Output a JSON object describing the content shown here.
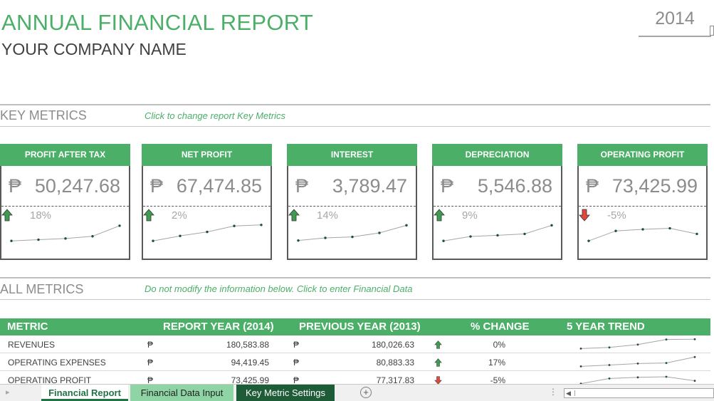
{
  "header": {
    "title": "ANNUAL FINANCIAL REPORT",
    "company": "YOUR COMPANY NAME",
    "year": "2014"
  },
  "key_metrics": {
    "title": "KEY METRICS",
    "note": "Click to change report Key Metrics",
    "currency": "₱",
    "cards": [
      {
        "label": "PROFIT AFTER TAX",
        "value": "50,247.68",
        "change": "18%",
        "direction": "up",
        "trend": [
          0.1,
          0.16,
          0.22,
          0.33,
          0.86
        ]
      },
      {
        "label": "NET PROFIT",
        "value": "67,474.85",
        "change": "2%",
        "direction": "up",
        "trend": [
          0.1,
          0.35,
          0.55,
          0.85,
          0.9
        ]
      },
      {
        "label": "INTEREST",
        "value": "3,789.47",
        "change": "14%",
        "direction": "up",
        "trend": [
          0.12,
          0.25,
          0.3,
          0.5,
          0.88
        ]
      },
      {
        "label": "DEPRECIATION",
        "value": "5,546.88",
        "change": "9%",
        "direction": "up",
        "trend": [
          0.1,
          0.32,
          0.38,
          0.45,
          0.88
        ]
      },
      {
        "label": "OPERATING PROFIT",
        "value": "73,425.99",
        "change": "-5%",
        "direction": "down",
        "trend": [
          0.1,
          0.6,
          0.68,
          0.73,
          0.45
        ]
      }
    ]
  },
  "all_metrics": {
    "title": "ALL METRICS",
    "note": "Do not modify the information below. Click to enter Financial Data",
    "headers": [
      "METRIC",
      "REPORT YEAR (2014)",
      "PREVIOUS YEAR (2013)",
      "% CHANGE",
      "5 YEAR TREND"
    ],
    "currency": "₱",
    "rows": [
      {
        "metric": "REVENUES",
        "report": "180,583.88",
        "previous": "180,026.63",
        "change": "0%",
        "direction": "up",
        "trend": [
          0.1,
          0.2,
          0.45,
          0.9,
          0.92
        ]
      },
      {
        "metric": "OPERATING EXPENSES",
        "report": "94,419.45",
        "previous": "80,883.33",
        "change": "17%",
        "direction": "up",
        "trend": [
          0.1,
          0.22,
          0.35,
          0.4,
          0.92
        ]
      },
      {
        "metric": "OPERATING PROFIT",
        "report": "73,425.99",
        "previous": "77,317.83",
        "change": "-5%",
        "direction": "down",
        "trend": [
          0.15,
          0.6,
          0.7,
          0.75,
          0.4
        ]
      }
    ]
  },
  "tabs": {
    "items": [
      "Financial Report",
      "Financial Data Input",
      "Key Metric Settings"
    ],
    "active": "Financial Report"
  },
  "colors": {
    "accent": "#4caf68",
    "up_arrow": "#3e9c52",
    "down_arrow": "#e0483e",
    "spark_line": "#a6a6a6",
    "spark_dot": "#1f4d3f"
  },
  "icons": {
    "up": "arrow-up-icon",
    "down": "arrow-down-icon",
    "add_sheet": "plus-circle-icon"
  }
}
